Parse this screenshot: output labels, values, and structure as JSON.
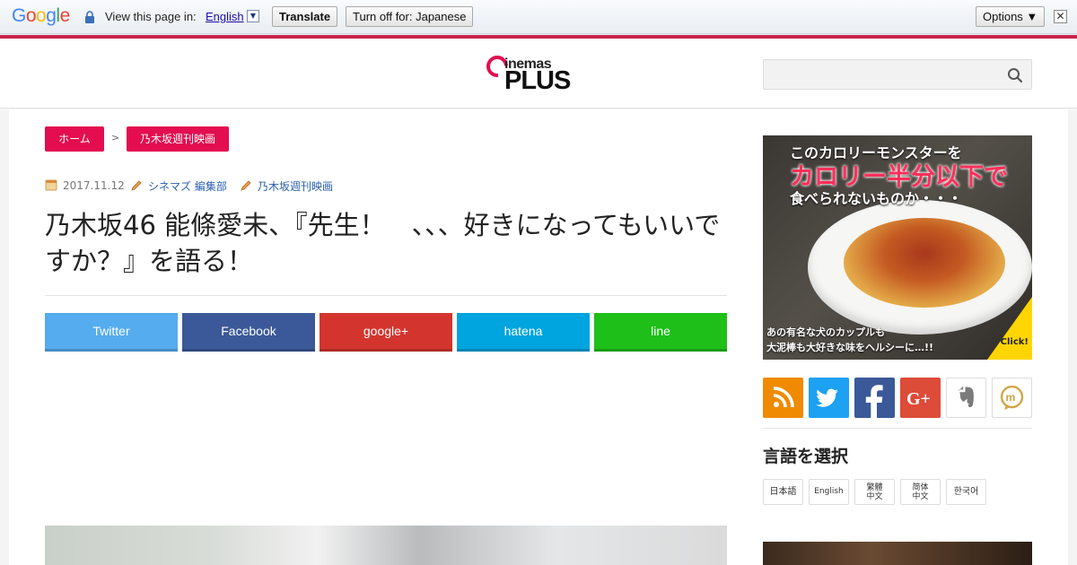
{
  "translate_bar": {
    "logo_letters": [
      "G",
      "o",
      "o",
      "g",
      "l",
      "e"
    ],
    "label": "View this page in:",
    "language": "English",
    "dropdown_arrow": "▼",
    "translate_label": "Translate",
    "turnoff_label": "Turn off for: Japanese",
    "options_label": "Options ▼",
    "close_glyph": "✕",
    "colors": {
      "blue": "#4285f4",
      "red": "#ea4335",
      "yellow": "#fbbc05",
      "green": "#34a853"
    }
  },
  "header": {
    "logo_small": "inemas",
    "logo_big": "PLUS",
    "search_placeholder": "",
    "accent": "#e30d4f"
  },
  "breadcrumb": {
    "home": "ホーム",
    "separator": ">",
    "category": "乃木坂週刊映画"
  },
  "meta": {
    "date": "2017.11.12",
    "author": "シネマズ 編集部",
    "category": "乃木坂週刊映画"
  },
  "article": {
    "title": "乃木坂46 能條愛未、『先生！　、、、好きになってもいいですか？』を語る！"
  },
  "share": {
    "twitter": "Twitter",
    "facebook": "Facebook",
    "google": "google+",
    "hatena": "hatena",
    "line": "line"
  },
  "ad": {
    "line1": "このカロリーモンスターを",
    "line2": "カロリー半分以下で",
    "line3": "食べられないものか・・・",
    "bottom1": "あの有名な犬のカップルも",
    "bottom2": "大泥棒も大好きな味をヘルシーに…!!",
    "click": "Click!"
  },
  "social_icons": [
    "rss-icon",
    "twitter-icon",
    "facebook-icon",
    "google-plus-icon",
    "evernote-icon",
    "mixi-icon"
  ],
  "language_select": {
    "title": "言語を選択",
    "ja": "日本語",
    "en": "English",
    "zh_tw_1": "繁體",
    "zh_tw_2": "中文",
    "zh_cn_1": "简体",
    "zh_cn_2": "中文",
    "ko": "한국어"
  }
}
